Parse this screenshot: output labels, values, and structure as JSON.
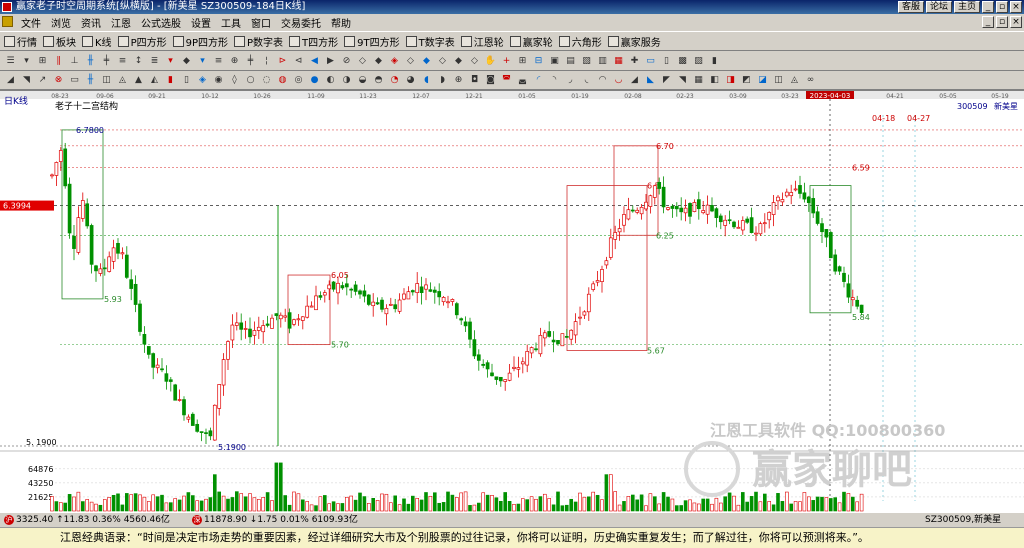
{
  "title_bar": {
    "title": "赢家老子时空周期系统[纵横版] - [新美星  SZ300509-184日K线]",
    "right_buttons": [
      "客服",
      "论坛",
      "主页"
    ],
    "window_buttons": [
      "_",
      "▫",
      "×"
    ]
  },
  "menu": {
    "items": [
      "文件",
      "浏览",
      "资讯",
      "江恩",
      "公式选股",
      "设置",
      "工具",
      "窗口",
      "交易委托",
      "帮助"
    ],
    "window_buttons": [
      "_",
      "▫",
      "×"
    ]
  },
  "toolbar1": {
    "items": [
      {
        "label": "行情",
        "icon": "grid-icon"
      },
      {
        "label": "板块",
        "icon": "blocks-icon"
      },
      {
        "label": "K线",
        "icon": "kline-icon"
      },
      {
        "label": "P四方形",
        "icon": "p-square-icon"
      },
      {
        "label": "9P四方形",
        "icon": "9p-square-icon"
      },
      {
        "label": "P数字表",
        "icon": "p-table-icon"
      },
      {
        "label": "T四方形",
        "icon": "t-square-icon"
      },
      {
        "label": "9T四方形",
        "icon": "9t-square-icon"
      },
      {
        "label": "T数字表",
        "icon": "t-table-icon"
      },
      {
        "label": "江恩轮",
        "icon": "gann-wheel-icon"
      },
      {
        "label": "赢家轮",
        "icon": "winner-wheel-icon"
      },
      {
        "label": "六角形",
        "icon": "hexagon-icon"
      },
      {
        "label": "赢家服务",
        "icon": "service-icon"
      }
    ]
  },
  "chart": {
    "period_label": "日K线",
    "indicator_label": "老子十二宫结构",
    "stock_code": "300509",
    "stock_name": "新美星",
    "current_price_tag": "6.3994",
    "volume_scale": [
      "64876",
      "43250",
      "21625"
    ],
    "low_label": "5.1900",
    "left_low_label": "5. 1900",
    "date_highlight": "2023-04-03",
    "dates": [
      "08-23",
      "09-06",
      "09-21",
      "10-12",
      "10-26",
      "11-09",
      "11-23",
      "12-07",
      "12-21",
      "01-05",
      "01-19",
      "02-08",
      "02-23",
      "03-09",
      "03-23",
      "2023-04-03",
      "04-21",
      "05-05",
      "05-19"
    ],
    "future_dates": [
      "04-18",
      "04-27"
    ],
    "box_labels": [
      "6.7800",
      "5.93",
      "6.05",
      "5.70",
      "6.70",
      "6.5",
      "6.25",
      "5.67",
      "6.59",
      "5.84"
    ],
    "watermark": {
      "line1": "江恩工具软件  QQ:100800360",
      "line2": "赢家聊吧"
    }
  },
  "chart_data": {
    "type": "candlestick",
    "title": "老子十二宫结构",
    "y_range": [
      5.19,
      6.85
    ],
    "key_levels": [
      6.78,
      6.7,
      6.59,
      6.5,
      6.4,
      6.25,
      6.05,
      5.93,
      5.84,
      5.7,
      5.67,
      5.19
    ],
    "current_price": 6.3994,
    "volume_ticks": [
      64876,
      43250,
      21625
    ]
  },
  "status": {
    "sh_label": "3325.40 ↑11.83 0.36% 4560.46亿",
    "sz_label": "11878.90 ↓1.75 0.01% 6109.93亿",
    "right_label": "SZ300509,新美星"
  },
  "bottom": {
    "quote": "江恩经典语录：“时间是决定市场走势的重要因素，经过详细研究大市及个别股票的过往记录，你将可以证明，历史确实重复发生；而了解过往，你将可以预测将来。”。"
  }
}
